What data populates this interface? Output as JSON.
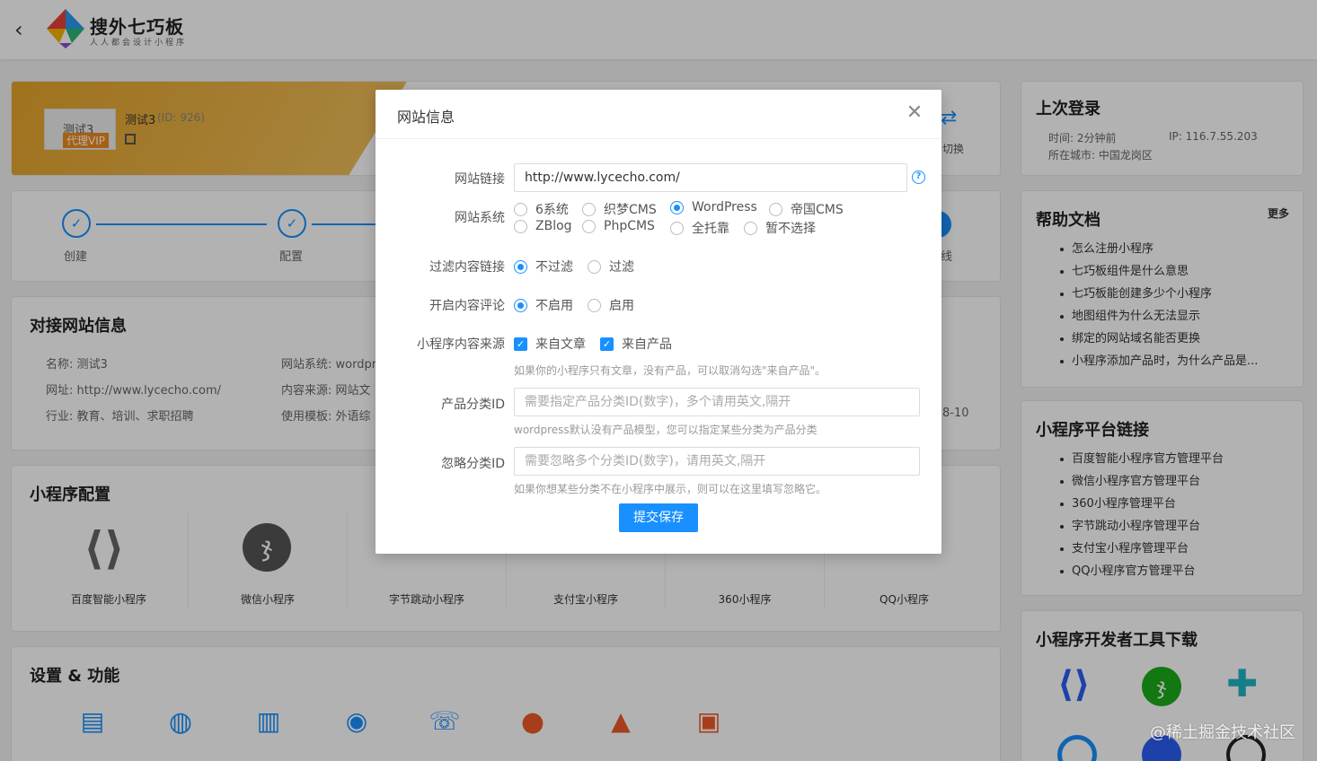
{
  "header": {
    "logo_title": "搜外七巧板",
    "logo_subtitle": "人人都会设计小程序"
  },
  "banner": {
    "site_name": "测试3",
    "site_id": "(ID: 926)",
    "vip_tag": "代理VIP",
    "thumb_text": "测试3",
    "switch_label": "切换"
  },
  "steps": [
    {
      "label": "创建"
    },
    {
      "label": "配置"
    },
    {
      "label": "线"
    }
  ],
  "site_info": {
    "title": "对接网站信息",
    "name": "名称:  测试3",
    "url": "网址:  http://www.lycecho.com/",
    "industry": "行业:  教育、培训、求职招聘",
    "system": "网站系统:  wordpr",
    "source": "内容来源:  网站文",
    "template": "使用模板:  外语综",
    "date_partial": "8-10"
  },
  "mini_config": {
    "title": "小程序配置",
    "items": [
      {
        "label": "百度智能小程序"
      },
      {
        "label": "微信小程序"
      },
      {
        "label": "字节跳动小程序"
      },
      {
        "label": "支付宝小程序"
      },
      {
        "label": "360小程序"
      },
      {
        "label": "QQ小程序"
      }
    ]
  },
  "features": {
    "title": "设置 & 功能"
  },
  "last_login": {
    "title": "上次登录",
    "time": "时间:  2分钟前",
    "ip": "IP:  116.7.55.203",
    "city": "所在城市:  中国龙岗区"
  },
  "help_docs": {
    "title": "帮助文档",
    "more": "更多",
    "items": [
      "怎么注册小程序",
      "七巧板组件是什么意思",
      "七巧板能创建多少个小程序",
      "地图组件为什么无法显示",
      "绑定的网站域名能否更换",
      "小程序添加产品时，为什么产品是..."
    ]
  },
  "platform_links": {
    "title": "小程序平台链接",
    "items": [
      "百度智能小程序官方管理平台",
      "微信小程序官方管理平台",
      "360小程序管理平台",
      "字节跳动小程序管理平台",
      "支付宝小程序管理平台",
      "QQ小程序官方管理平台"
    ]
  },
  "dev_tools": {
    "title": "小程序开发者工具下载"
  },
  "modal": {
    "title": "网站信息",
    "url_label": "网站链接",
    "url_value": "http://www.lycecho.com/",
    "system_label": "网站系统",
    "system_options": [
      "6系统",
      "织梦CMS",
      "WordPress",
      "帝国CMS",
      "ZBlog",
      "PhpCMS",
      "全托靠",
      "暂不选择"
    ],
    "system_selected": "WordPress",
    "filter_label": "过滤内容链接",
    "filter_options": [
      "不过滤",
      "过滤"
    ],
    "comment_label": "开启内容评论",
    "comment_options": [
      "不启用",
      "启用"
    ],
    "source_label": "小程序内容来源",
    "source_options": [
      "来自文章",
      "来自产品"
    ],
    "source_hint": "如果你的小程序只有文章，没有产品，可以取消勾选\"来自产品\"。",
    "product_cat_label": "产品分类ID",
    "product_cat_placeholder": "需要指定产品分类ID(数字)，多个请用英文,隔开",
    "product_cat_hint": "wordpress默认没有产品模型，您可以指定某些分类为产品分类",
    "ignore_cat_label": "忽略分类ID",
    "ignore_cat_placeholder": "需要忽略多个分类ID(数字)，请用英文,隔开",
    "ignore_cat_hint": "如果你想某些分类不在小程序中展示，则可以在这里填写忽略它。",
    "submit": "提交保存"
  },
  "watermark": "@稀土掘金技术社区",
  "colors": {
    "primary": "#1890ff",
    "banner": "#e8a317"
  }
}
